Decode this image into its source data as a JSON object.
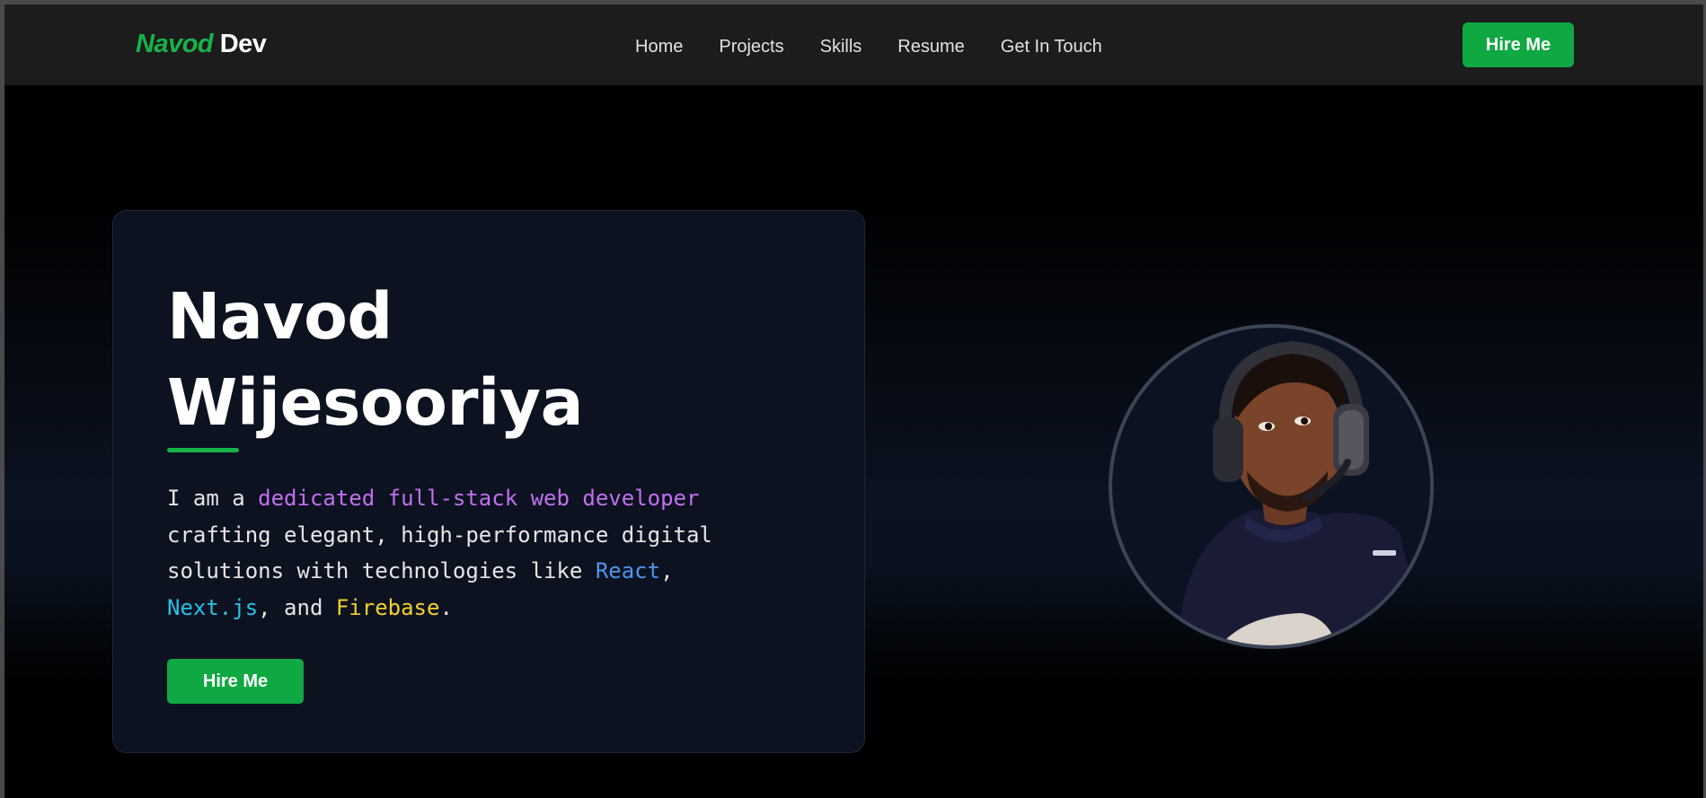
{
  "nav": {
    "logo_first": "Navod",
    "logo_second": "Dev",
    "links": [
      "Home",
      "Projects",
      "Skills",
      "Resume",
      "Get In Touch"
    ],
    "hire_label": "Hire Me"
  },
  "hero": {
    "name_line1": "Navod",
    "name_line2": "Wijesooriya",
    "desc": {
      "intro": "I am a ",
      "role": "dedicated full-stack web developer",
      "middle": " crafting elegant, high-performance digital solutions with technologies like ",
      "tech1": "React",
      "comma": ",",
      "tech2": "Next.js",
      "and": ", and ",
      "tech3": "Firebase",
      "period": "."
    },
    "hire_label": "Hire Me"
  },
  "colors": {
    "accent_green": "#0fa842",
    "logo_green": "#16b34a",
    "highlight_purple": "#c26fef",
    "highlight_blue": "#4d95f0",
    "highlight_cyan": "#22c5e6",
    "highlight_yellow": "#f3d12e"
  }
}
